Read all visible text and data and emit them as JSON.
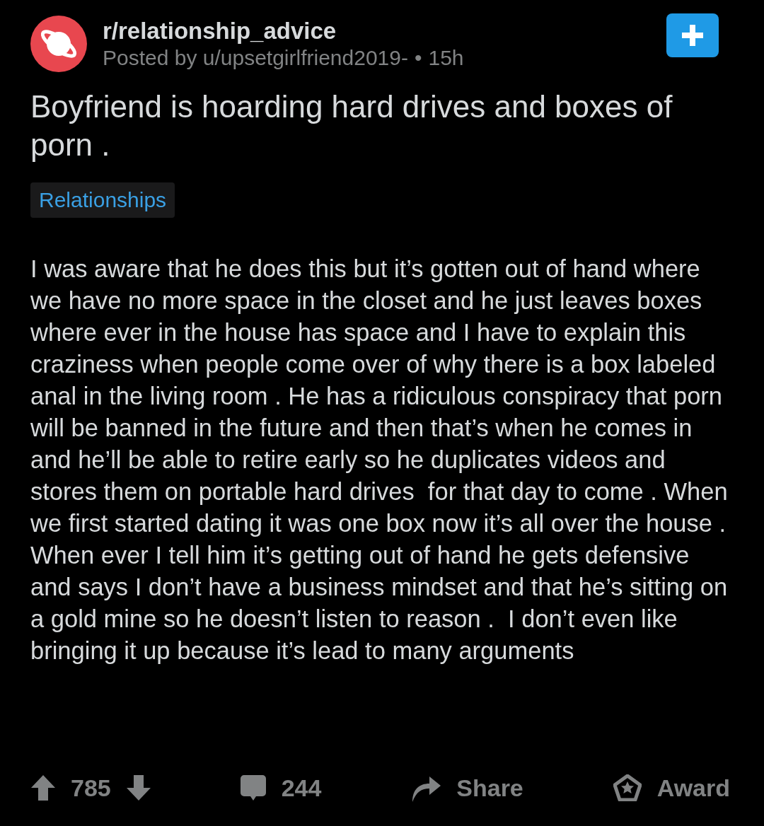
{
  "post": {
    "subreddit": "r/relationship_advice",
    "posted_by": "Posted by u/upsetgirlfriend2019-",
    "separator": "•",
    "age": "15h",
    "title": "Boyfriend is hoarding hard drives and boxes of porn .",
    "flair": "Relationships",
    "body": "I was aware that he does this but it’s gotten out of hand where we have no more space in the closet and he just leaves boxes where ever in the house has space and I have to explain this craziness when people come over of why there is a box labeled anal in the living room . He has a ridiculous conspiracy that porn will be banned in the future and then that’s when he comes in and he’ll be able to retire early so he duplicates videos and stores them on portable hard drives  for that day to come . When we first started dating it was one box now it’s all over the house .  When ever I tell him it’s getting out of hand he gets defensive and says I don’t have a business mindset and that he’s sitting on a gold mine so he doesn’t listen to reason .  I don’t even like bringing it up because it’s lead to many arguments"
  },
  "actions": {
    "score": "785",
    "comments": "244",
    "share": "Share",
    "award": "Award"
  }
}
